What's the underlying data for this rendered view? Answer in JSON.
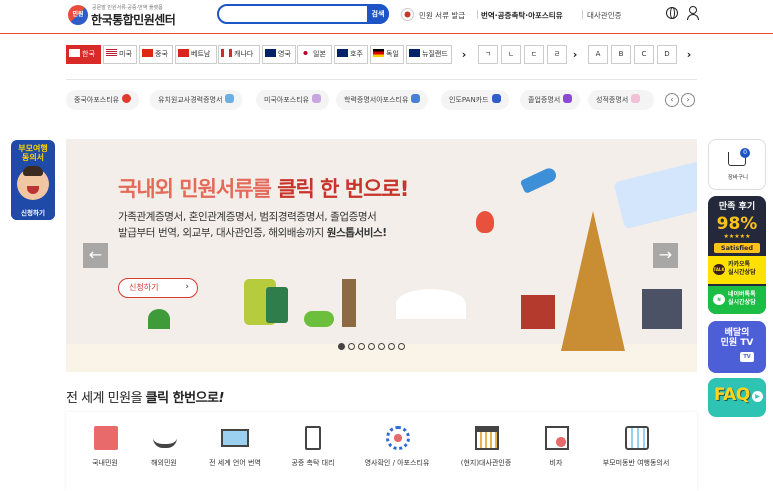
{
  "header": {
    "logo_mark": "민원",
    "logo_subtitle": "공문발 민원서류·공증·번역 플랫폼",
    "logo_title": "한국통합민원센터",
    "search": {
      "value": "",
      "placeholder": "",
      "button_label": "검색"
    },
    "nav": [
      {
        "label": "민원 서류 발급"
      },
      {
        "label": "번역·공증촉탁·아포스티유"
      },
      {
        "label": "대사관인증"
      }
    ]
  },
  "country_tabs": [
    {
      "label": "한국",
      "active": true,
      "flag_color": "#c0392b"
    },
    {
      "label": "미국",
      "active": false,
      "flag_color": "#b22234"
    },
    {
      "label": "중국",
      "active": false,
      "flag_color": "#de2910"
    },
    {
      "label": "베트남",
      "active": false,
      "flag_color": "#da251d"
    },
    {
      "label": "캐나다",
      "active": false,
      "flag_color": "#d52b1e"
    },
    {
      "label": "영국",
      "active": false,
      "flag_color": "#012169"
    },
    {
      "label": "일본",
      "active": false,
      "flag_color": "#bc002d"
    },
    {
      "label": "호주",
      "active": false,
      "flag_color": "#012169"
    },
    {
      "label": "독일",
      "active": false,
      "flag_color": "#000000"
    },
    {
      "label": "뉴질랜드",
      "active": false,
      "flag_color": "#012169"
    }
  ],
  "letter_tabs": [
    "ㄱ",
    "ㄴ",
    "ㄷ",
    "ㄹ",
    "A",
    "B",
    "C",
    "D"
  ],
  "doc_pills": [
    {
      "label": "중국아포스티유",
      "color": "#e03a2f"
    },
    {
      "label": "유치원교사경력증명서",
      "color": "#6ab0e0"
    },
    {
      "label": "미국아포스티유",
      "color": "#c7a6e0"
    },
    {
      "label": "학력증명서아포스티유",
      "color": "#4a7fd6"
    },
    {
      "label": "인도PAN카드",
      "color": "#2d5fc7"
    },
    {
      "label": "졸업증명서",
      "color": "#8a4ad6"
    },
    {
      "label": "성적증명서",
      "color": "#f2c0d8"
    }
  ],
  "left_banner": {
    "title_line1": "부모여행",
    "title_line2": "동의서",
    "button": "신청하기"
  },
  "hero": {
    "title_part1": "국내외 민원서류를 ",
    "title_part2": "클릭 한 번으로!",
    "line1": "가족관계증명서, 혼인관계증명서, 범죄경력증명서, 졸업증명서",
    "line2_normal": "발급부터 번역, 외교부, 대사관인증, 해외배송까지 ",
    "line2_bold": "원스톱서비스!",
    "cta": "신청하기",
    "prev_label": "←",
    "next_label": "→",
    "slide_count": 7,
    "active_slide": 1
  },
  "right_rail": {
    "cart": {
      "label": "장바구니",
      "count": "0"
    },
    "review": {
      "title": "만족 후기",
      "percent": "98%",
      "stars": "★★★★★",
      "satisfied": "Satisfied",
      "kakao_line1": "카카오톡",
      "kakao_line2": "실시간상담",
      "naver_line1": "네이버톡톡",
      "naver_line2": "실시간상담"
    },
    "tv": {
      "line1": "배달의",
      "line2": "민원 TV",
      "badge": "TV"
    },
    "faq": {
      "label": "FAQ"
    }
  },
  "services_section": {
    "title_normal": "전 세계 민원을 ",
    "title_bold": "클릭 한번으로",
    "title_suffix": "!",
    "items": [
      {
        "label": "국내민원",
        "icon": "document-folder-icon"
      },
      {
        "label": "해외민원",
        "icon": "airplane-icon"
      },
      {
        "label": "전 세계 언어 번역",
        "icon": "translation-card-icon"
      },
      {
        "label": "공증 촉탁 대리",
        "icon": "notary-badge-icon"
      },
      {
        "label": "영사확인 / 아포스티유",
        "icon": "gear-seal-icon"
      },
      {
        "label": "(현지)대사관인증",
        "icon": "embassy-building-icon"
      },
      {
        "label": "비자",
        "icon": "visa-globe-icon"
      },
      {
        "label": "부모미동반 여행동의서",
        "icon": "luggage-icon"
      }
    ]
  },
  "colors": {
    "brand_red": "#d92a2a",
    "brand_blue": "#1e55c6",
    "hero_bg": "#f3eee9"
  }
}
